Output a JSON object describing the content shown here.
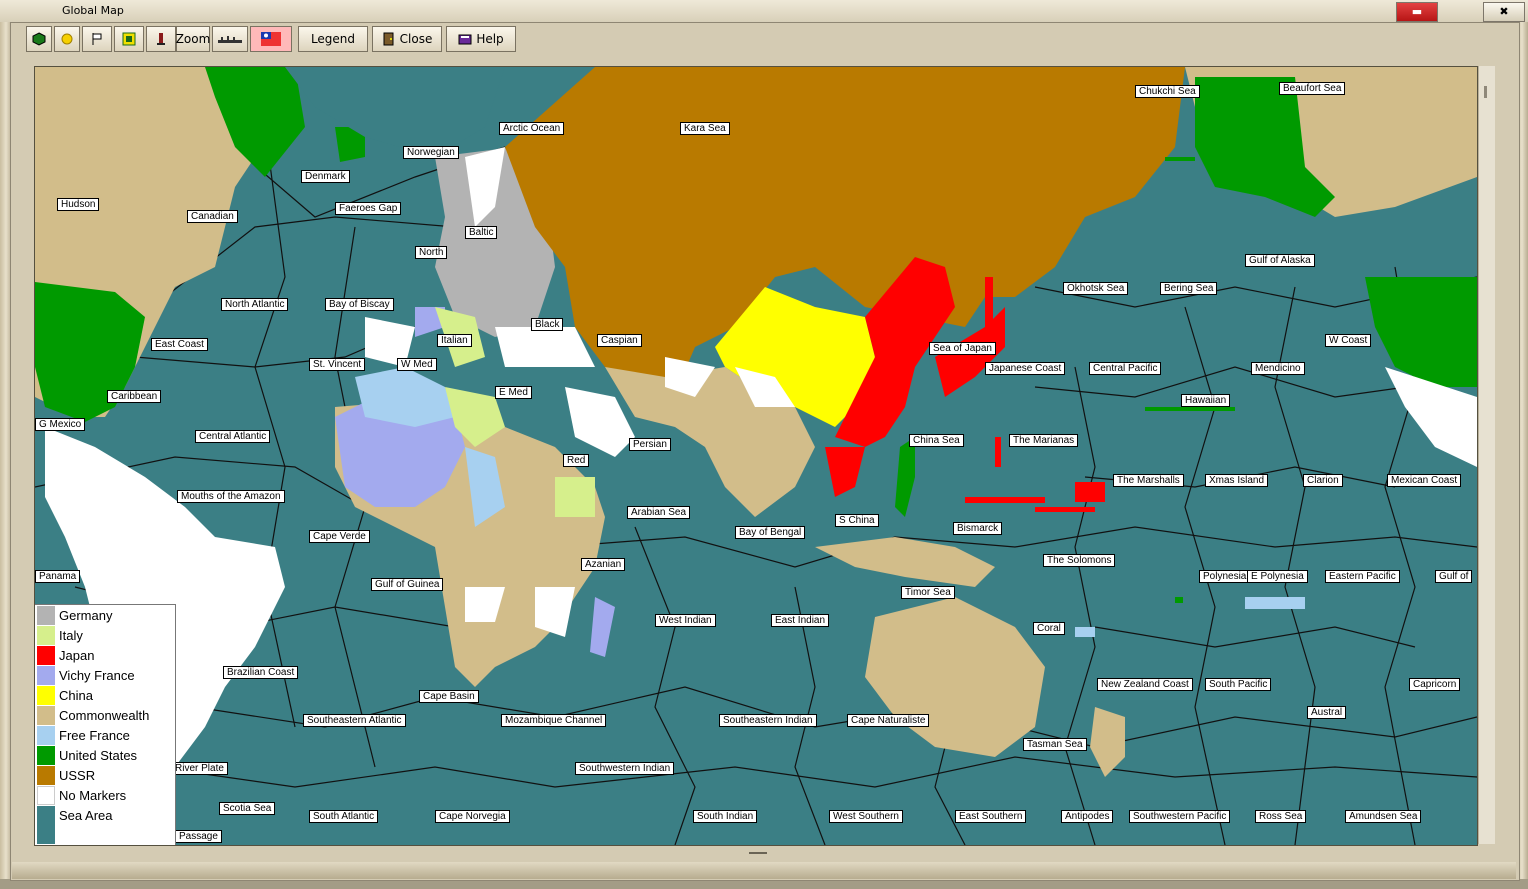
{
  "window": {
    "title": "Global Map",
    "controls": [
      "▬",
      "✖"
    ]
  },
  "toolbar": {
    "zoom_label": "Zoom",
    "legend_label": "Legend",
    "close_label": "Close",
    "help_label": "Help"
  },
  "legend": {
    "items": [
      {
        "label": "Germany",
        "color": "#b3b3b3"
      },
      {
        "label": "Italy",
        "color": "#d6ef8c"
      },
      {
        "label": "Japan",
        "color": "#ff0000"
      },
      {
        "label": "Vichy France",
        "color": "#a3aaee"
      },
      {
        "label": "China",
        "color": "#ffff00"
      },
      {
        "label": "Commonwealth",
        "color": "#d2bd8a"
      },
      {
        "label": "Free France",
        "color": "#a7d0f0"
      },
      {
        "label": "United States",
        "color": "#009a00"
      },
      {
        "label": "USSR",
        "color": "#b97a00"
      },
      {
        "label": "No Markers",
        "color": "#ffffff"
      },
      {
        "label": "Sea Area",
        "color": "#3b7f85"
      }
    ]
  },
  "sea_labels": [
    "Chukchi Sea",
    "Beaufort Sea",
    "Arctic Ocean",
    "Kara Sea",
    "Norwegian",
    "Denmark",
    "Hudson",
    "Canadian",
    "Faeroes Gap",
    "Baltic",
    "North",
    "Gulf of Alaska",
    "Okhotsk Sea",
    "Bering Sea",
    "North Atlantic",
    "Bay of Biscay",
    "Black",
    "Italian",
    "Caspian",
    "Sea of Japan",
    "W Coast",
    "East Coast",
    "St. Vincent",
    "W Med",
    "Japanese Coast",
    "Central Pacific",
    "Mendicino",
    "E Med",
    "Caribbean",
    "Hawaiian",
    "G Mexico",
    "Central Atlantic",
    "China Sea",
    "The Marianas",
    "Persian",
    "Red",
    "The Marshalls",
    "Xmas Island",
    "Clarion",
    "Mexican Coast",
    "Mouths of the Amazon",
    "Arabian Sea",
    "S China",
    "Bismarck",
    "Bay of Bengal",
    "Cape Verde",
    "Azanian",
    "The Solomons",
    "Panama",
    "Polynesia",
    "E Polynesia",
    "Eastern Pacific",
    "Gulf of",
    "Gulf of Guinea",
    "Timor Sea",
    "West Indian",
    "East Indian",
    "Coral",
    "Brazilian Coast",
    "Cape Basin",
    "New Zealand Coast",
    "South Pacific",
    "Capricorn",
    "Austral",
    "Southeastern Atlantic",
    "Mozambique Channel",
    "Southeastern Indian",
    "Cape Naturaliste",
    "Tasman Sea",
    "River Plate",
    "Southwestern Indian",
    "Scotia Sea",
    "South Atlantic",
    "Cape Norvegia",
    "South Indian",
    "West Southern",
    "East Southern",
    "Antipodes",
    "Southwestern Pacific",
    "Ross Sea",
    "Amundsen Sea",
    "Passage"
  ]
}
